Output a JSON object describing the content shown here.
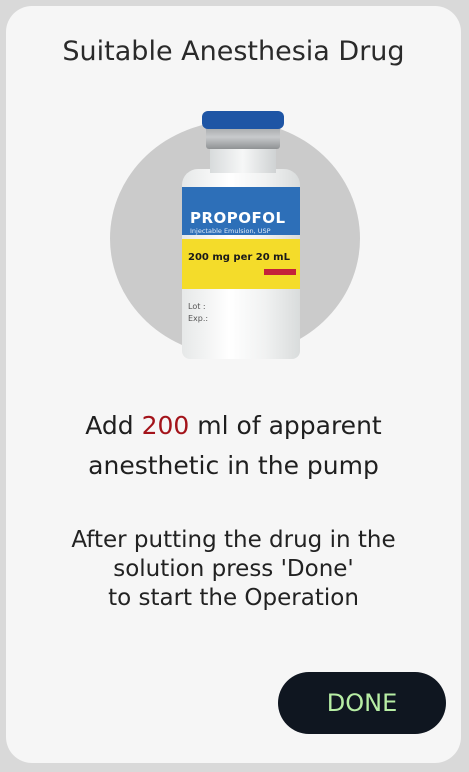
{
  "dialog": {
    "title": "Suitable Anesthesia Drug",
    "instruction": {
      "prefix": "Add ",
      "amount": "200",
      "suffix": " ml of apparent",
      "line2": "anesthetic in the pump"
    },
    "note": {
      "line1": "After putting the drug in the",
      "line2": "solution press 'Done'",
      "line3": "to start the Operation"
    },
    "done_label": "DONE"
  },
  "vial_label": {
    "name": "PROPOFOL",
    "subtitle": "Injectable Emulsion, USP",
    "concentration": "200 mg per 20 mL",
    "lot": "Lot :",
    "exp": "Exp.:"
  },
  "colors": {
    "amount_highlight": "#a3131a",
    "button_bg": "#0f1620",
    "button_text": "#b7eea4"
  }
}
